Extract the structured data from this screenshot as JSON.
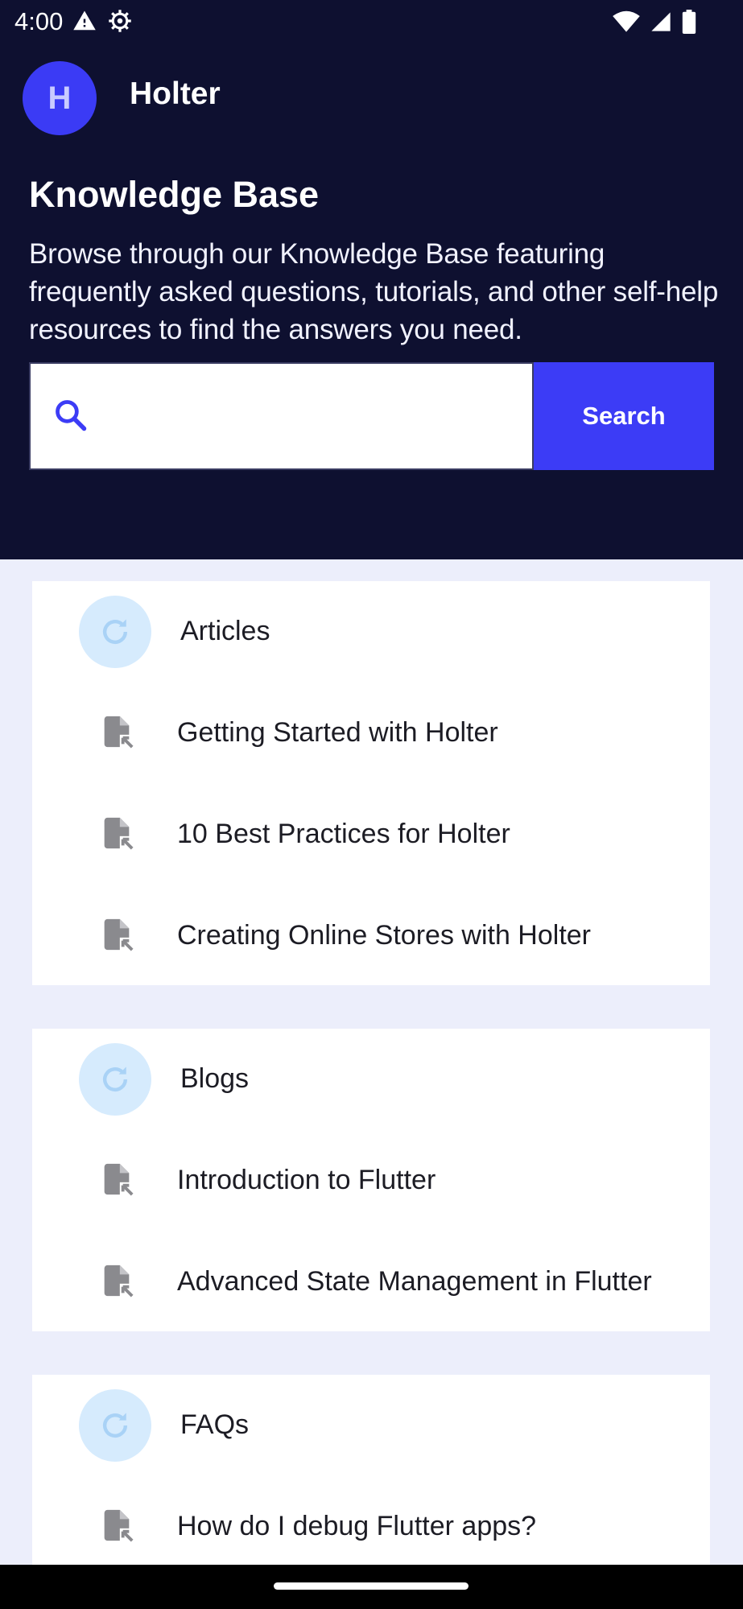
{
  "status_bar": {
    "time": "4:00",
    "icons_left": [
      "warning-icon",
      "settings-icon"
    ],
    "icons_right": [
      "wifi-icon",
      "signal-icon",
      "battery-icon"
    ]
  },
  "header": {
    "avatar_letter": "H",
    "app_title": "Holter",
    "title": "Knowledge Base",
    "description": "Browse through our Knowledge Base featuring frequently asked questions, tutorials, and other self-help resources to find the answers you need."
  },
  "search": {
    "value": "",
    "placeholder": "",
    "button_label": "Search"
  },
  "sections": [
    {
      "label": "Articles",
      "items": [
        {
          "label": "Getting Started with Holter"
        },
        {
          "label": "10 Best Practices for Holter"
        },
        {
          "label": "Creating Online Stores with Holter"
        }
      ]
    },
    {
      "label": "Blogs",
      "items": [
        {
          "label": "Introduction to Flutter"
        },
        {
          "label": "Advanced State Management in Flutter"
        }
      ]
    },
    {
      "label": "FAQs",
      "items": [
        {
          "label": "How do I debug Flutter apps?"
        }
      ]
    }
  ],
  "colors": {
    "header_bg": "#0e1030",
    "accent": "#3c3cf6",
    "page_bg": "#eceefb",
    "category_circle": "#d6ebfd",
    "icon_gray": "#8a8a8e"
  }
}
